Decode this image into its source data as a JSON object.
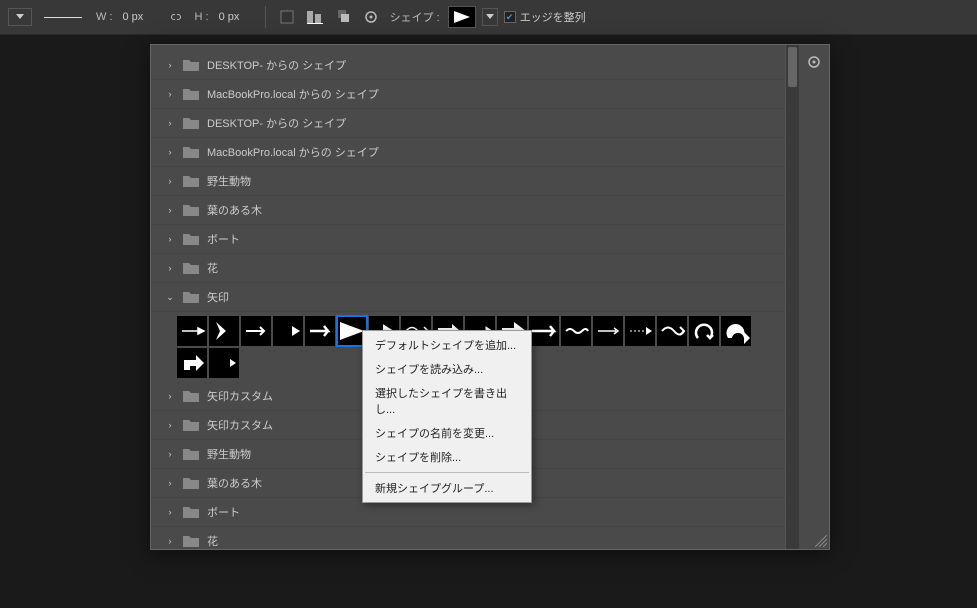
{
  "toolbar": {
    "w_label": "W :",
    "w_value": "0 px",
    "h_label": "H :",
    "h_value": "0 px",
    "shape_label": "シェイプ :",
    "align_edges_label": "エッジを整列"
  },
  "panel": {
    "folders": [
      {
        "label": "DESKTOP- からの シェイプ",
        "expanded": false
      },
      {
        "label": "MacBookPro.local からの シェイプ",
        "expanded": false
      },
      {
        "label": "DESKTOP- からの シェイプ",
        "expanded": false
      },
      {
        "label": "MacBookPro.local からの シェイプ",
        "expanded": false
      },
      {
        "label": "野生動物",
        "expanded": false
      },
      {
        "label": "葉のある木",
        "expanded": false
      },
      {
        "label": "ボート",
        "expanded": false
      },
      {
        "label": "花",
        "expanded": false
      },
      {
        "label": "矢印",
        "expanded": true
      },
      {
        "label": "矢印カスタム",
        "expanded": false
      },
      {
        "label": "矢印カスタム",
        "expanded": false
      },
      {
        "label": "野生動物",
        "expanded": false
      },
      {
        "label": "葉のある木",
        "expanded": false
      },
      {
        "label": "ボート",
        "expanded": false
      },
      {
        "label": "花",
        "expanded": false
      }
    ],
    "arrows_count": 20,
    "selected_index": 5
  },
  "context_menu": {
    "items": [
      "デフォルトシェイプを追加...",
      "シェイプを読み込み...",
      "選択したシェイプを書き出し...",
      "シェイプの名前を変更...",
      "シェイプを削除..."
    ],
    "group_item": "新規シェイプグループ..."
  }
}
